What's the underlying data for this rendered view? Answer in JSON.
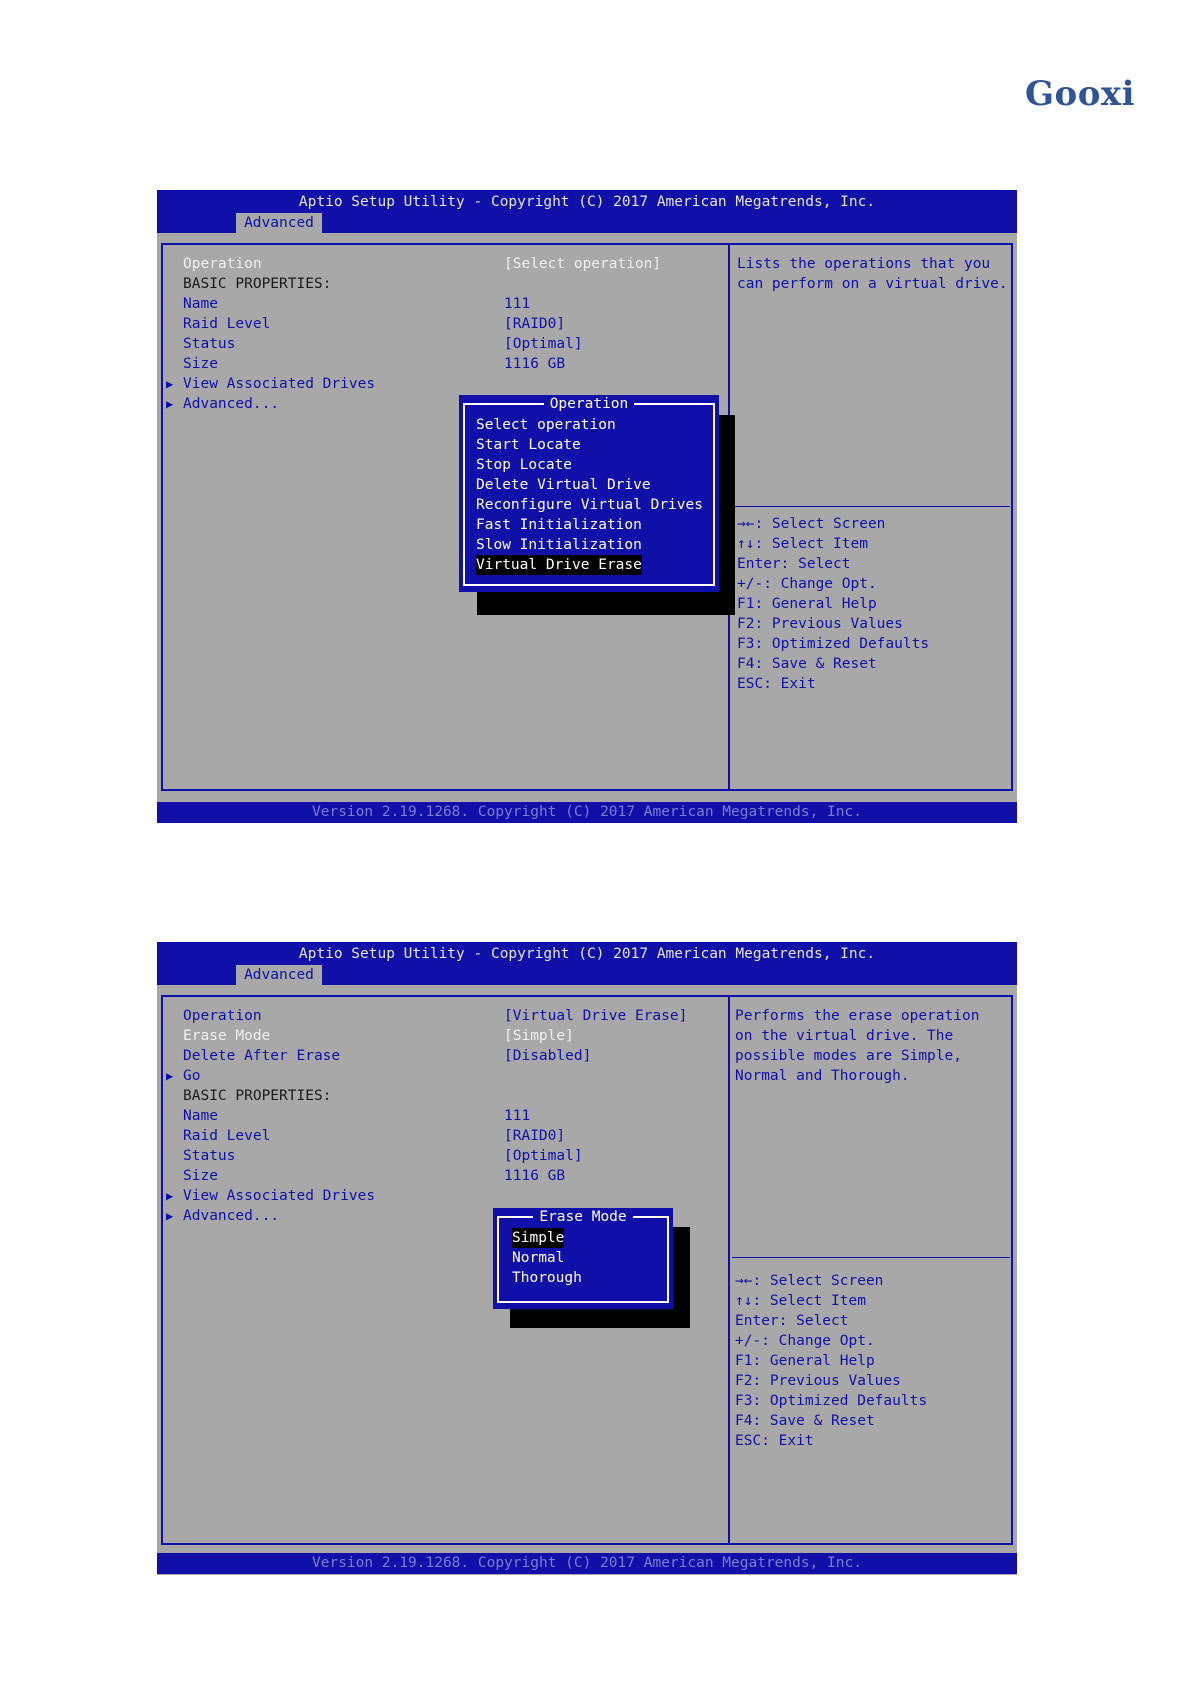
{
  "logo": {
    "text": "Gooxi"
  },
  "bios_common": {
    "title": "Aptio Setup Utility - Copyright (C) 2017 American Megatrends, Inc.",
    "tab": "Advanced",
    "footer": "Version 2.19.1268. Copyright (C) 2017 American Megatrends, Inc.",
    "keys": [
      "→←: Select Screen",
      "↑↓: Select Item",
      "Enter: Select",
      "+/-: Change Opt.",
      "F1: General Help",
      "F2: Previous Values",
      "F3: Optimized Defaults",
      "F4: Save & Reset",
      "ESC: Exit"
    ],
    "submenu_marker": "▶"
  },
  "screen1": {
    "rows": [
      {
        "label": "Operation",
        "value": "[Select operation]"
      },
      {
        "label": "BASIC PROPERTIES:",
        "value": ""
      },
      {
        "label": "Name",
        "value": "111"
      },
      {
        "label": "Raid Level",
        "value": "[RAID0]"
      },
      {
        "label": "Status",
        "value": "[Optimal]"
      },
      {
        "label": "Size",
        "value": "1116 GB"
      },
      {
        "label": "View Associated Drives",
        "value": ""
      },
      {
        "label": "Advanced...",
        "value": ""
      }
    ],
    "help": [
      "Lists the operations that you",
      "can perform on a virtual drive."
    ],
    "popup": {
      "title": "Operation",
      "options": [
        "Select operation",
        "Start Locate",
        "Stop Locate",
        "Delete Virtual Drive",
        "Reconfigure Virtual Drives",
        "Fast Initialization",
        "Slow Initialization",
        "Virtual Drive Erase"
      ],
      "selected": "Virtual Drive Erase"
    }
  },
  "screen2": {
    "rows": [
      {
        "label": "Operation",
        "value": "[Virtual Drive Erase]"
      },
      {
        "label": "Erase Mode",
        "value": "[Simple]"
      },
      {
        "label": "Delete After Erase",
        "value": "[Disabled]"
      },
      {
        "label": "Go",
        "value": ""
      },
      {
        "label": "BASIC PROPERTIES:",
        "value": ""
      },
      {
        "label": "Name",
        "value": "111"
      },
      {
        "label": "Raid Level",
        "value": "[RAID0]"
      },
      {
        "label": "Status",
        "value": "[Optimal]"
      },
      {
        "label": "Size",
        "value": "1116 GB"
      },
      {
        "label": "View Associated Drives",
        "value": ""
      },
      {
        "label": "Advanced...",
        "value": ""
      }
    ],
    "help": [
      "Performs the erase operation",
      "on the virtual drive. The",
      "possible modes are Simple,",
      "Normal and Thorough."
    ],
    "popup": {
      "title": "Erase Mode",
      "options": [
        "Simple",
        "Normal",
        "Thorough"
      ],
      "selected": "Simple"
    }
  },
  "colors": {
    "bios_blue": "#1010a8",
    "bios_gray": "#a8a8a8",
    "logo_blue": "#2f5597",
    "highlight": "#000000"
  }
}
